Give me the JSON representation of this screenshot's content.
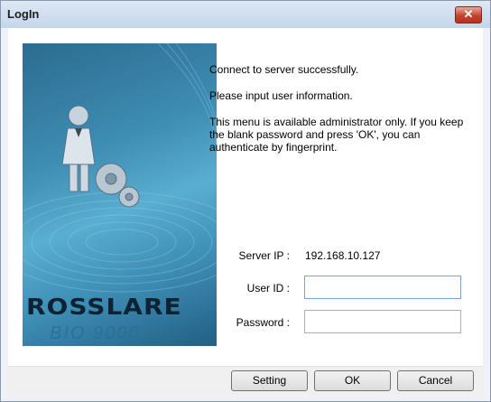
{
  "window": {
    "title": "LogIn",
    "close_symbol": "✕"
  },
  "banner": {
    "brand": "ROSSLARE",
    "product": "BIO 9000"
  },
  "messages": {
    "line1": "Connect to server successfully.",
    "line2": "Please input user information.",
    "line3": "This menu is available administrator only. If you keep the blank password and press 'OK', you can authenticate by fingerprint."
  },
  "form": {
    "server_ip_label": "Server IP :",
    "server_ip_value": "192.168.10.127",
    "user_id_label": "User ID :",
    "user_id_value": "",
    "password_label": "Password :",
    "password_value": ""
  },
  "buttons": {
    "setting": "Setting",
    "ok": "OK",
    "cancel": "Cancel"
  }
}
